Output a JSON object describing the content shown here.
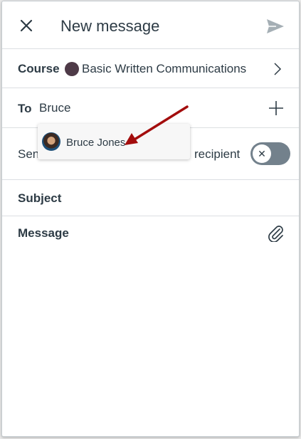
{
  "header": {
    "title": "New message",
    "close_icon": "close-icon",
    "send_icon": "send-icon"
  },
  "course": {
    "label": "Course",
    "name": "Basic Written Communications",
    "dot_color": "#4e3a47"
  },
  "to": {
    "label": "To",
    "value": "Bruce"
  },
  "send_individually": {
    "label_left": "Sen",
    "label_right": "recipient",
    "toggle_state": "off"
  },
  "suggestion": {
    "name": "Bruce Jones"
  },
  "subject": {
    "label": "Subject"
  },
  "message": {
    "label": "Message"
  },
  "colors": {
    "text": "#2d3b45",
    "annotation_arrow": "#a30d0d",
    "toggle": "#73818c"
  }
}
